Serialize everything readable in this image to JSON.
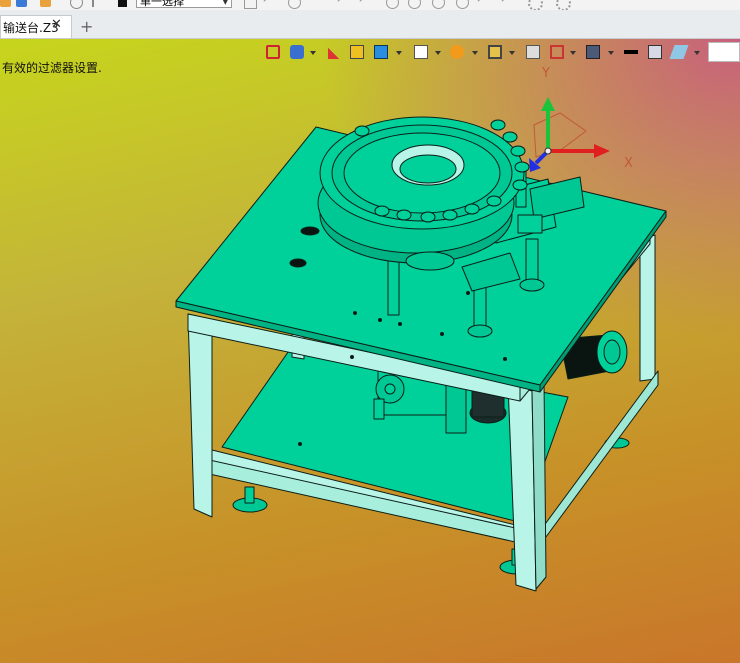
{
  "toolbar": {
    "selection_mode": "单一选择",
    "icons": [
      "undo-icon",
      "save-icon",
      "redo-icon",
      "stop-icon",
      "snap-icon",
      "pointer-icon",
      "filter-icon",
      "line-icon",
      "arc-icon",
      "circle-icon",
      "point-icon",
      "settings-icon"
    ]
  },
  "tabs": [
    {
      "label": "输送台.Z3",
      "active": true
    }
  ],
  "add_tab_symbol": "+",
  "close_symbol": "✕",
  "status_message": "有效的过滤器设置.",
  "view_toolbar": {
    "icons": [
      "exit-icon",
      "view-manager-icon",
      "pen-icon",
      "box-icon",
      "cube-icon",
      "white-cube-icon",
      "render-mode-icon",
      "zoom-icon",
      "view-grid-icon",
      "section-icon",
      "monitor-icon",
      "color-swatch-icon",
      "background-icon",
      "layer-icon",
      "light-icon"
    ]
  },
  "triad": {
    "x_label": "X",
    "y_label": "Y"
  },
  "colors": {
    "part": "#00d09a",
    "edge": "#0b1f18",
    "light_part": "#b8f5e8"
  }
}
